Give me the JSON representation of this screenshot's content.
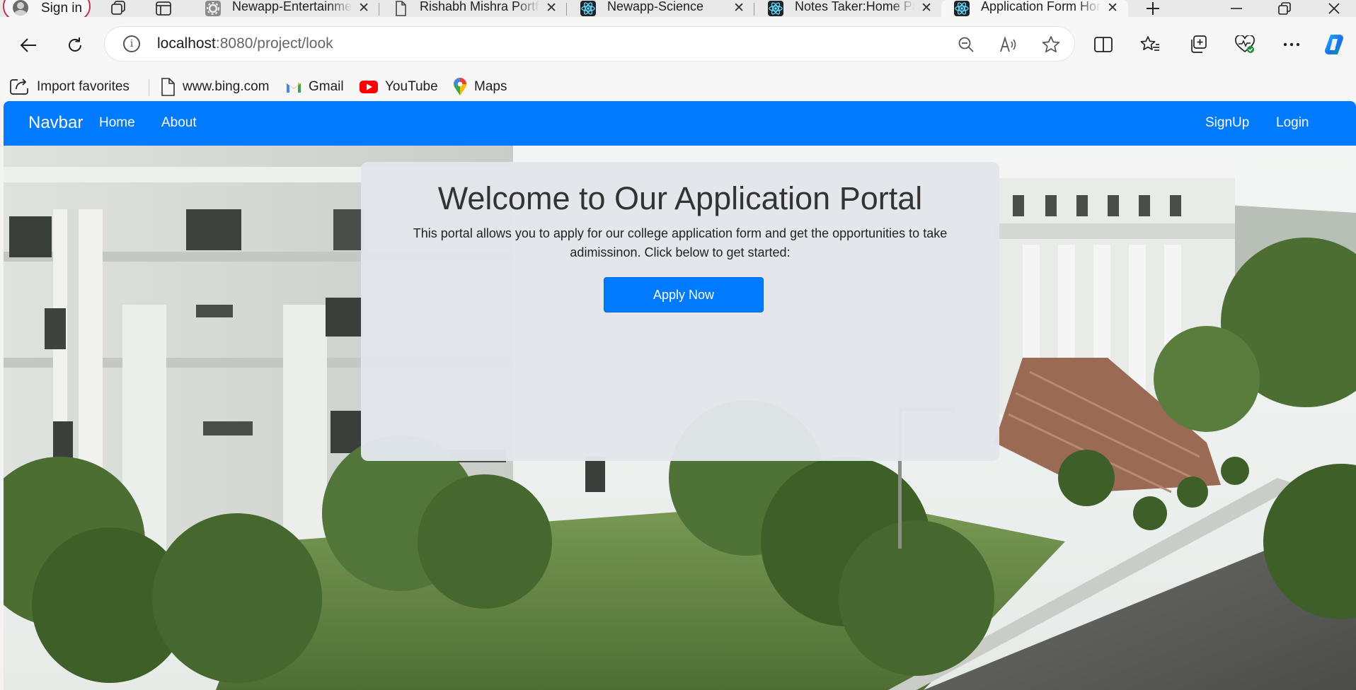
{
  "browser": {
    "signin_label": "Sign in",
    "tabs": [
      {
        "title": "Newapp-Entertainment",
        "icon": "gear-favicon-icon",
        "active": false
      },
      {
        "title": "Rishabh Mishra Portfolio",
        "icon": "document-icon",
        "active": false
      },
      {
        "title": "Newapp-Science",
        "icon": "react-icon",
        "active": false
      },
      {
        "title": "Notes Taker:Home Page",
        "icon": "react-icon",
        "active": false
      },
      {
        "title": "Application Form Home",
        "icon": "react-icon",
        "active": true
      }
    ],
    "address": {
      "host": "localhost",
      "path": ":8080/project/look"
    },
    "favorites": [
      {
        "label": "Import favorites",
        "icon": "import-favorites-icon"
      },
      {
        "label": "www.bing.com",
        "icon": "document-icon"
      },
      {
        "label": "Gmail",
        "icon": "gmail-icon"
      },
      {
        "label": "YouTube",
        "icon": "youtube-icon"
      },
      {
        "label": "Maps",
        "icon": "maps-pin-icon"
      }
    ]
  },
  "page": {
    "navbar": {
      "brand": "Navbar",
      "links": [
        "Home",
        "About"
      ],
      "right_links": [
        "SignUp",
        "Login"
      ]
    },
    "hero": {
      "title": "Welcome to Our Application Portal",
      "description": "This portal allows you to apply for our college application form and get the opportunities to take adimissinon. Click below to get started:",
      "button_label": "Apply Now"
    }
  },
  "colors": {
    "navbar_bg": "#007bff",
    "button_bg": "#007bff",
    "card_bg": "#e2e6eb",
    "signin_border": "#c4314b"
  }
}
